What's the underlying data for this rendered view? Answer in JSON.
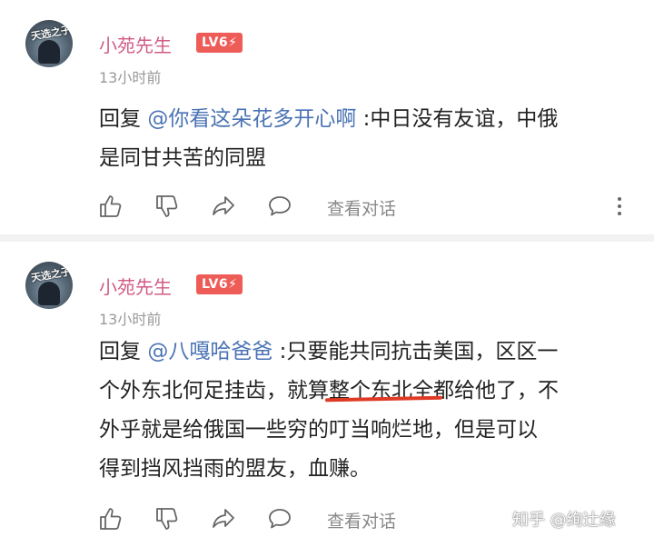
{
  "comments": [
    {
      "avatar_label": "天选之子",
      "username": "小苑先生",
      "level_badge": "LV6⚡",
      "time": "13小时前",
      "reply_prefix": "回复 ",
      "mention": "@你看这朵花多开心啊",
      "text_line1": " :中日没有友谊，中俄",
      "text_line2": "是同甘共苦的同盟",
      "view_dialog": "查看对话"
    },
    {
      "avatar_label": "天选之子",
      "username": "小苑先生",
      "level_badge": "LV6⚡",
      "time": "13小时前",
      "reply_prefix": "回复 ",
      "mention": "@八嘎哈爸爸",
      "text_part1": " :只要能共同抗击美国，区区一",
      "text_part2": "个外东北何足挂齿，就算",
      "text_underlined": "整个东北全",
      "text_part3": "都给他了，不",
      "text_part4": "外乎就是给俄国一些穷的叮当响烂地，但是可以",
      "text_part5": "得到挡风挡雨的盟友，血赚。",
      "view_dialog": "查看对话"
    }
  ],
  "watermark": "知乎 @绚辻缘",
  "colors": {
    "username": "#d15b86",
    "mention": "#4a73b4",
    "badge": "#ee5c58",
    "underline": "#e03a25"
  },
  "icons": [
    "like-icon",
    "dislike-icon",
    "share-icon",
    "comment-icon",
    "more-vertical-icon"
  ]
}
